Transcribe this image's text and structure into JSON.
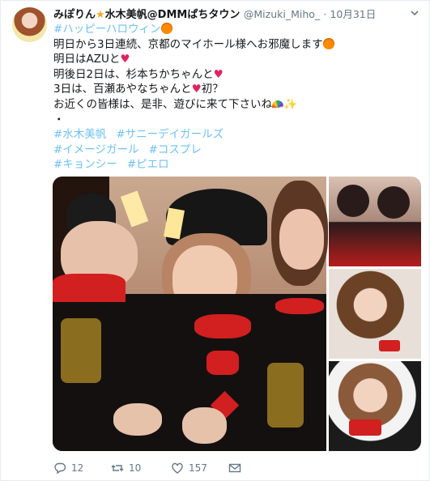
{
  "tweet": {
    "display_name": "みぽりん",
    "display_name_rest": "水木美帆@DMMぱちタウン",
    "handle": "@Mizuki_Miho_",
    "dot": "·",
    "time": "10月31日",
    "lines": {
      "l1": "#ハッピーハロウィン",
      "l2": "明日から3日連続、京都のマイホール様へお邪魔します",
      "l3": "明日はAZUと",
      "l4": "明後日2日は、杉本ちかちゃんと",
      "l5a": "3日は、百瀬あやなちゃんと",
      "l5b": "初？",
      "l6": "お近くの皆様は、是非、遊びに来て下さいね",
      "l7": "・"
    },
    "hashtags": [
      [
        "#水木美帆",
        "#サニーデイガールズ"
      ],
      [
        "#イメージガール",
        "#コスプレ"
      ],
      [
        "#キョンシー",
        "#ピエロ"
      ]
    ],
    "emoji": {
      "heart": "♥",
      "sparkle": "✨"
    },
    "media_alt": "Four photos of women in jiangshi Halloween costumes with face paint",
    "stats": {
      "replies": "12",
      "retweets": "10",
      "likes": "157"
    },
    "icons": [
      "reply-icon",
      "retweet-icon",
      "like-icon",
      "message-icon",
      "chevron-down-icon"
    ],
    "colors": {
      "link": "#1da1f2",
      "muted": "#657786",
      "heart": "#e0245e"
    }
  }
}
